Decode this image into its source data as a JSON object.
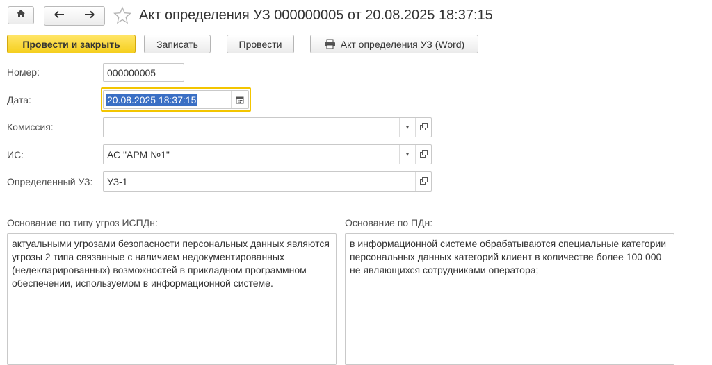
{
  "window": {
    "title": "Акт определения УЗ 000000005 от 20.08.2025 18:37:15",
    "home_icon": "home-icon",
    "back_icon": "arrow-left-icon",
    "forward_icon": "arrow-right-icon",
    "favorite_icon": "star-icon"
  },
  "toolbar": {
    "post_close_label": "Провести и закрыть",
    "save_label": "Записать",
    "post_label": "Провести",
    "print_label": "Акт определения УЗ (Word)",
    "print_icon": "printer-icon",
    "accent_color": "#f5cf1e"
  },
  "form": {
    "number": {
      "label": "Номер:",
      "value": "000000005"
    },
    "date": {
      "label": "Дата:",
      "value": "20.08.2025 18:37:15",
      "calendar_icon": "calendar-icon"
    },
    "commission": {
      "label": "Комиссия:",
      "value": ""
    },
    "system": {
      "label": "ИС:",
      "value": "АС \"АРМ №1\""
    },
    "level": {
      "label": "Определенный УЗ:",
      "value": "УЗ-1"
    }
  },
  "threat_basis": {
    "label": "Основание по типу угроз ИСПДн:",
    "text": "актуальными угрозами безопасности персональных данных являются угрозы 2 типа связанные с наличием недокументированных (недекларированных) возможностей в прикладном программном обеспечении, используемом в информационной системе."
  },
  "pd_basis": {
    "label": "Основание по ПДн:",
    "text": "в информационной системе обрабатываются специальные категории персональных данных категорий клиент в количестве более 100 000 не являющихся сотрудниками оператора;"
  }
}
